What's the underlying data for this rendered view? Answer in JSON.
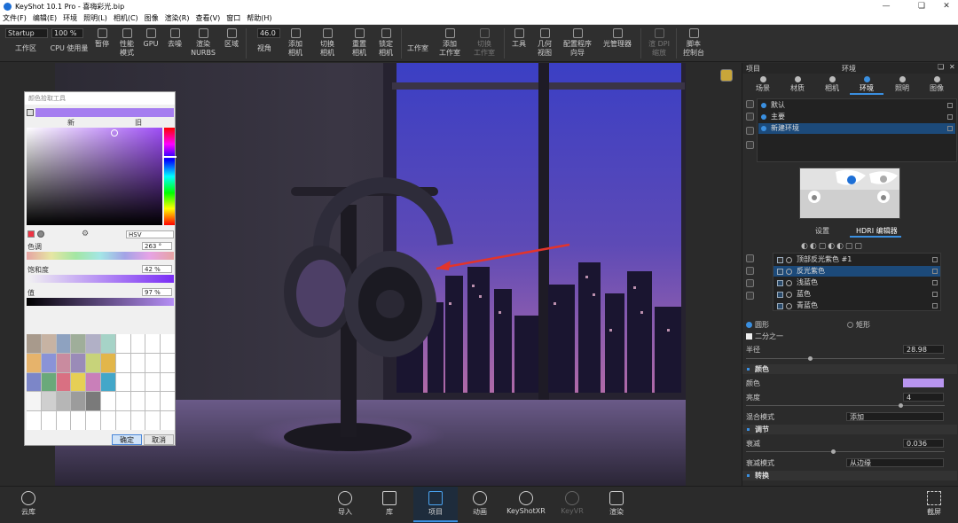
{
  "window": {
    "title": "KeyShot 10.1 Pro  - 喜嗨彩光.bip"
  },
  "menu": [
    "文件(F)",
    "编辑(E)",
    "环境",
    "照明(L)",
    "相机(C)",
    "图像",
    "渲染(R)",
    "查看(V)",
    "窗口",
    "帮助(H)"
  ],
  "toolbar": {
    "workspace_value": "Startup",
    "cpu_value": "100 %",
    "fov_value": "46.0",
    "items": [
      "工作区",
      "CPU 使用量",
      "暂停",
      "性能\n模式",
      "GPU",
      "去噪",
      "渲染\nNURBS",
      "区域",
      "视角",
      "添加\n相机",
      "切换\n相机",
      "重置\n相机",
      "锁定\n相机",
      "工作室",
      "添加\n工作室",
      "切换\n工作室",
      "工具",
      "几何\n视图",
      "配置程序\n向导",
      "光管理器",
      "渲 DPI\n缩放",
      "脚本\n控制台"
    ]
  },
  "picker": {
    "title": "颜色拾取工具",
    "new_label": "新",
    "old_label": "旧",
    "mode_value": "HSV",
    "hue_label": "色调",
    "hue_value": "263 °",
    "sat_label": "饱和度",
    "sat_value": "42 %",
    "val_label": "值",
    "val_value": "97 %",
    "ok_label": "确定",
    "cancel_label": "取消",
    "swatch_colors": [
      "#a89a8c",
      "#c7b3a3",
      "#8ea2c0",
      "#9fae9a",
      "#b1b0c6",
      "#a6d3c7",
      "#fff",
      "#fff",
      "#fff",
      "#fff",
      "#e6b36b",
      "#8a93d7",
      "#c98b9f",
      "#9a8bb8",
      "#c7d37a",
      "#e2b64a",
      "#fff",
      "#fff",
      "#fff",
      "#fff",
      "#7c86c8",
      "#6aa97a",
      "#d97082",
      "#e6cf55",
      "#c97fb9",
      "#43a7c9",
      "#fff",
      "#fff",
      "#fff",
      "#fff",
      "#f4f4f4",
      "#cfcfcf",
      "#b6b6b6",
      "#9c9c9c",
      "#7a7a7a",
      "#fff",
      "#fff",
      "#fff",
      "#fff",
      "#fff",
      "#fff",
      "#fff",
      "#fff",
      "#fff",
      "#fff",
      "#fff",
      "#fff",
      "#fff",
      "#fff",
      "#fff"
    ]
  },
  "panel": {
    "project_label": "项目",
    "env_label": "环境",
    "tabs": [
      "场景",
      "材质",
      "相机",
      "环境",
      "照明",
      "图像"
    ],
    "active_tab": "环境",
    "env_items": [
      "默认",
      "主要",
      "新建环境"
    ],
    "subtabs": [
      "设置",
      "HDRI 编辑器"
    ],
    "layers": [
      "顶部反光紫色 #1",
      "反光紫色",
      "浅蓝色",
      "蓝色",
      "青蓝色"
    ],
    "shape_circle": "圆形",
    "shape_rect": "矩形",
    "half_label": "二分之一",
    "radius_label": "半径",
    "radius_value": "28.98",
    "color_section": "颜色",
    "color_label": "颜色",
    "color_swatch": "#b895f0",
    "brightness_label": "亮度",
    "brightness_value": "4",
    "blend_label": "混合模式",
    "blend_value": "添加",
    "adjust_section": "调节",
    "falloff_label": "衰减",
    "falloff_value": "0.036",
    "falloff_mode_label": "衰减模式",
    "falloff_mode_value": "从边缘",
    "transform_section": "转换"
  },
  "bottom": {
    "cloud": "云库",
    "import": "导入",
    "library": "库",
    "project": "项目",
    "animation": "动画",
    "keyshotxr": "KeyShotXR",
    "keyvr": "KeyVR",
    "render": "渲染",
    "screenshot": "截屏"
  }
}
